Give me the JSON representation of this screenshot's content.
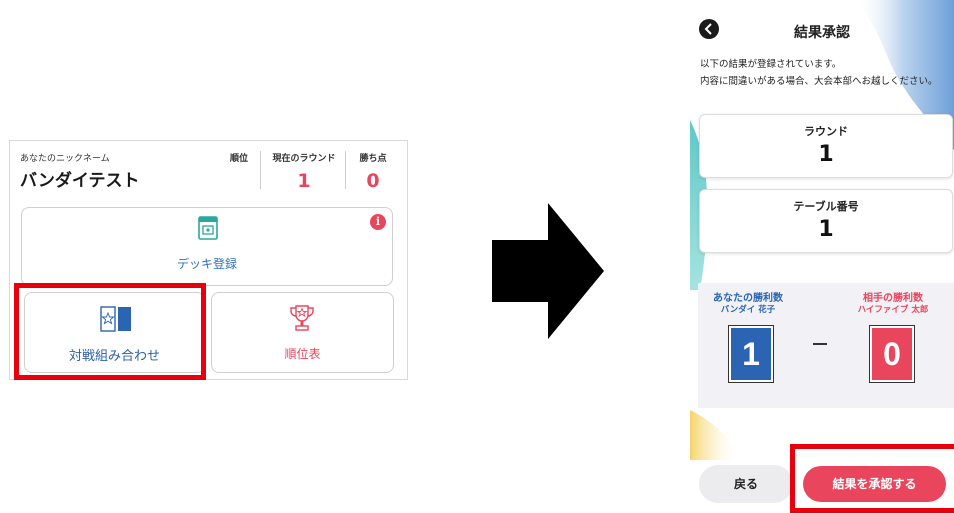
{
  "home": {
    "nickname_label": "あなたのニックネーム",
    "nickname": "バンダイテスト",
    "stats": [
      {
        "label": "順位",
        "value": ""
      },
      {
        "label": "現在のラウンド",
        "value": "1"
      },
      {
        "label": "勝ち点",
        "value": "0"
      }
    ],
    "deck_button": "デッキ登録",
    "notice_badge": "i",
    "match_button": "対戦組み合わせ",
    "ranking_button": "順位表"
  },
  "confirm": {
    "title": "結果承認",
    "message_line1": "以下の結果が登録されています。",
    "message_line2": "内容に間違いがある場合、大会本部へお越しください。",
    "round_label": "ラウンド",
    "round_value": "1",
    "table_label": "テーブル番号",
    "table_value": "1",
    "my_wins_label": "あなたの勝利数",
    "my_name": "バンダイ 花子",
    "my_wins": "1",
    "opp_wins_label": "相手の勝利数",
    "opp_name": "ハイファイブ 太郎",
    "opp_wins": "0",
    "back_button": "戻る",
    "approve_button": "結果を承認する"
  },
  "colors": {
    "accent_red": "#e9455c",
    "accent_blue": "#2a64b2",
    "highlight_box": "#e8000d"
  }
}
